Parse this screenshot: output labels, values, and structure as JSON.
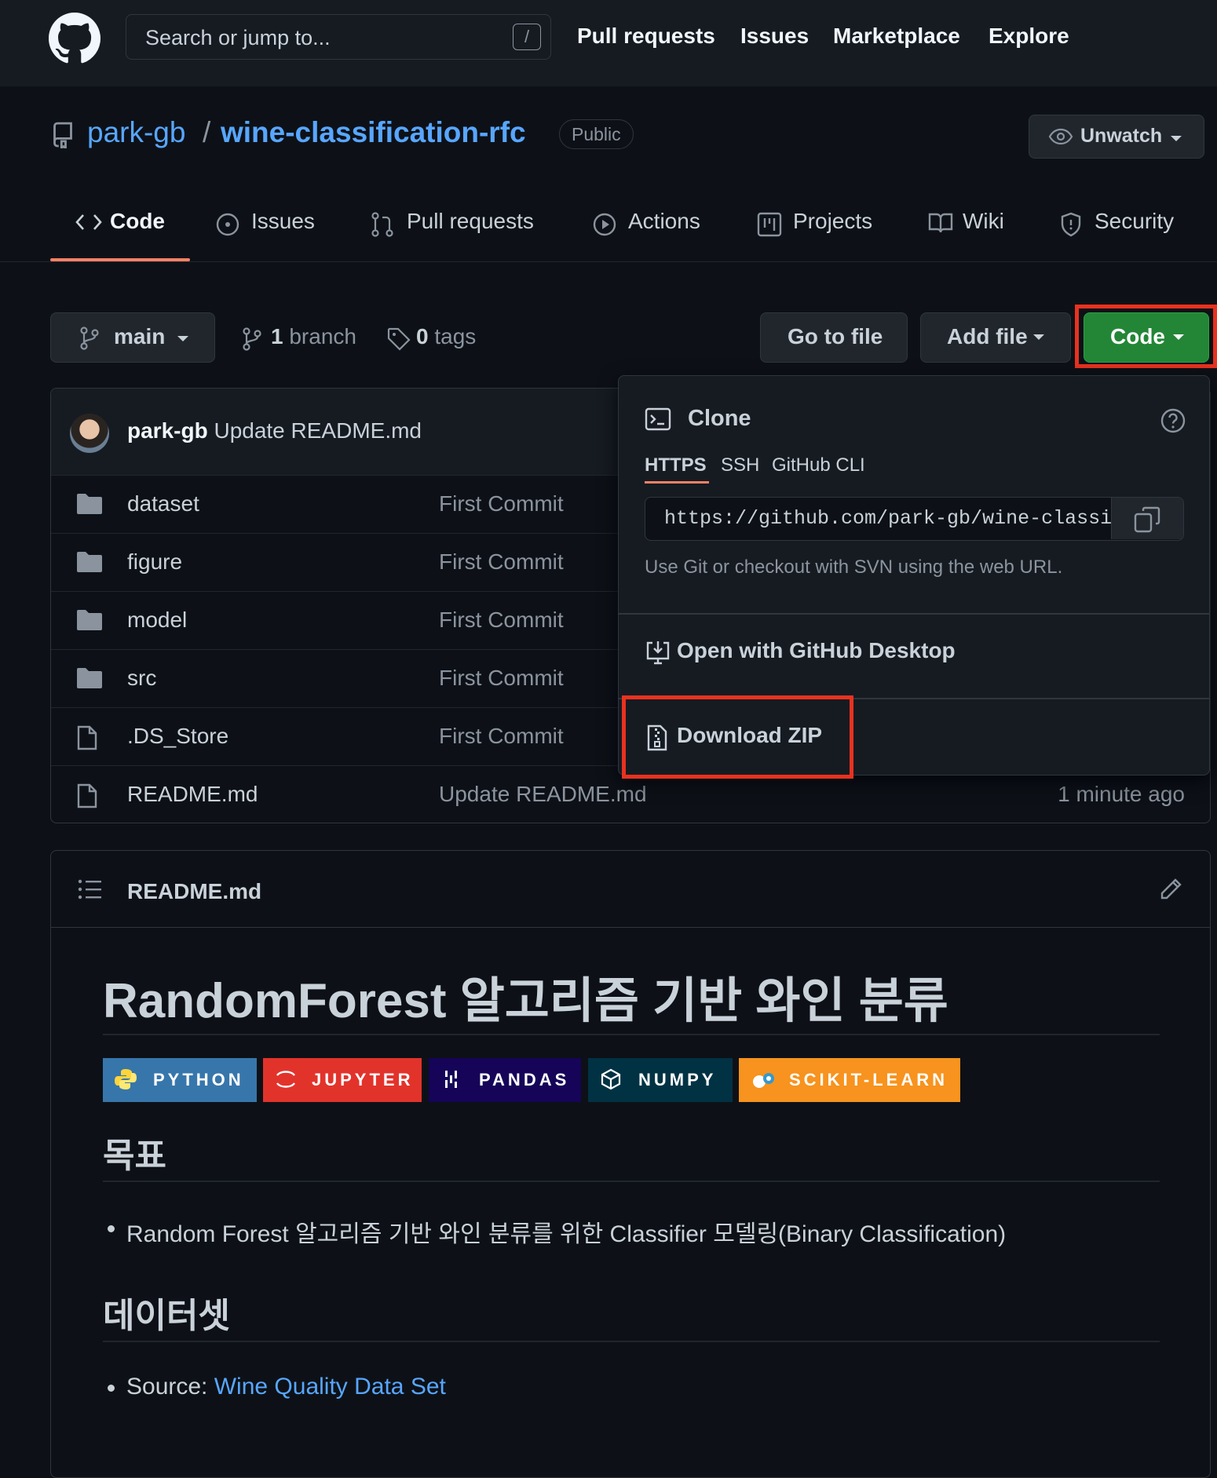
{
  "header": {
    "search_placeholder": "Search or jump to...",
    "search_shortcut": "/",
    "nav": [
      "Pull requests",
      "Issues",
      "Marketplace",
      "Explore"
    ]
  },
  "repo": {
    "owner": "park-gb",
    "separator": "/",
    "name": "wine-classification-rfc",
    "visibility": "Public",
    "watch_label": "Unwatch"
  },
  "tabs": [
    {
      "label": "Code",
      "icon": "code-icon",
      "active": true
    },
    {
      "label": "Issues",
      "icon": "issue-icon"
    },
    {
      "label": "Pull requests",
      "icon": "pull-request-icon"
    },
    {
      "label": "Actions",
      "icon": "play-icon"
    },
    {
      "label": "Projects",
      "icon": "project-icon"
    },
    {
      "label": "Wiki",
      "icon": "book-icon"
    },
    {
      "label": "Security",
      "icon": "shield-icon"
    }
  ],
  "branch_bar": {
    "branch": "main",
    "branch_count": "1",
    "branch_word": "branch",
    "tag_count": "0",
    "tag_word": "tags",
    "go_to_file": "Go to file",
    "add_file": "Add file",
    "code": "Code"
  },
  "latest_commit": {
    "author": "park-gb",
    "message": "Update README.md"
  },
  "files": [
    {
      "name": "dataset",
      "type": "folder",
      "message": "First Commit",
      "time": ""
    },
    {
      "name": "figure",
      "type": "folder",
      "message": "First Commit",
      "time": ""
    },
    {
      "name": "model",
      "type": "folder",
      "message": "First Commit",
      "time": ""
    },
    {
      "name": "src",
      "type": "folder",
      "message": "First Commit",
      "time": ""
    },
    {
      "name": ".DS_Store",
      "type": "file",
      "message": "First Commit",
      "time": ""
    },
    {
      "name": "README.md",
      "type": "file",
      "message": "Update README.md",
      "time": "1 minute ago"
    }
  ],
  "clone_menu": {
    "title": "Clone",
    "tabs": [
      "HTTPS",
      "SSH",
      "GitHub CLI"
    ],
    "url": "https://github.com/park-gb/wine-classification-rfc.git",
    "hint": "Use Git or checkout with SVN using the web URL.",
    "open_desktop": "Open with GitHub Desktop",
    "download_zip": "Download ZIP"
  },
  "readme": {
    "filename": "README.md",
    "title": "RandomForest 알고리즘 기반 와인 분류",
    "badges": [
      {
        "label": "PYTHON",
        "color": "#3776ab"
      },
      {
        "label": "JUPYTER",
        "color": "#e2332b"
      },
      {
        "label": "PANDAS",
        "color": "#150458"
      },
      {
        "label": "NUMPY",
        "color": "#013243"
      },
      {
        "label": "SCIKIT-LEARN",
        "color": "#f7931e"
      }
    ],
    "goal_heading": "목표",
    "goal_item": "Random Forest 알고리즘 기반 와인 분류를 위한 Classifier 모델링(Binary Classification)",
    "dataset_heading": "데이터셋",
    "source_label": "Source: ",
    "source_link": "Wine Quality Data Set"
  },
  "colors": {
    "page_bg": "#0d1117",
    "header_bg": "#161b22",
    "link": "#58a6ff",
    "primary_button": "#238636",
    "tab_underline": "#f78166",
    "highlight_box": "#e8321f"
  }
}
